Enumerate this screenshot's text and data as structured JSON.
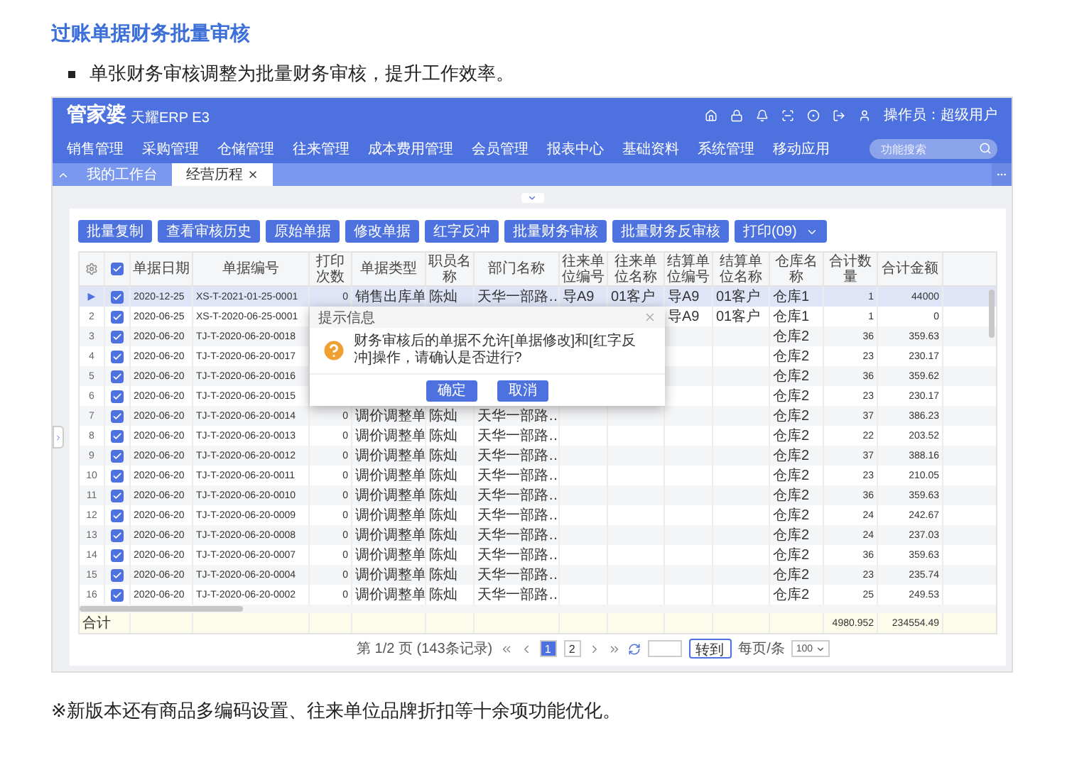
{
  "article": {
    "heading": "过账单据财务批量审核",
    "bullets": [
      "单张财务审核调整为批量财务审核，提升工作效率。"
    ],
    "note": "※新版本还有商品多编码设置、往来单位品牌折扣等十余项功能优化。"
  },
  "app": {
    "logo": "管家婆",
    "product": "天耀ERP E3",
    "operator": "操作员：超级用户",
    "search": {
      "placeholder": "功能搜索"
    },
    "nav": [
      "销售管理",
      "采购管理",
      "仓储管理",
      "往来管理",
      "成本费用管理",
      "会员管理",
      "报表中心",
      "基础资料",
      "系统管理",
      "移动应用"
    ],
    "tabs": [
      {
        "label": "我的工作台",
        "selected": false,
        "closable": false
      },
      {
        "label": "经营历程",
        "selected": true,
        "closable": true
      }
    ],
    "toolbar": [
      {
        "label": "批量复制",
        "caret": false
      },
      {
        "label": "查看审核历史",
        "caret": false
      },
      {
        "label": "原始单据",
        "caret": false
      },
      {
        "label": "修改单据",
        "caret": false
      },
      {
        "label": "红字反冲",
        "caret": false
      },
      {
        "label": "批量财务审核",
        "caret": false
      },
      {
        "label": "批量财务反审核",
        "caret": false
      },
      {
        "label": "打印(09)",
        "caret": true
      }
    ],
    "table": {
      "header_checked": true,
      "columns": [
        "单据日期",
        "单据编号",
        "打印次数",
        "单据类型",
        "职员名称",
        "部门名称",
        "往来单位编号",
        "往来单位名称",
        "结算单位编号",
        "结算单位名称",
        "仓库名称",
        "合计数量",
        "合计金额"
      ],
      "rows": [
        {
          "index": "▶",
          "selected": true,
          "checked": true,
          "cells": [
            "2020-12-25",
            "XS-T-2021-01-25-0001",
            "0",
            "销售出库单",
            "陈灿",
            "天华一部路…",
            "导A9",
            "01客户",
            "导A9",
            "01客户",
            "仓库1",
            "1",
            "44000"
          ]
        },
        {
          "index": "2",
          "selected": false,
          "checked": true,
          "cells": [
            "2020-06-25",
            "XS-T-2020-06-25-0001",
            null,
            null,
            null,
            null,
            null,
            null,
            "导A9",
            "01客户",
            "仓库1",
            "1",
            "0"
          ]
        },
        {
          "index": "3",
          "selected": false,
          "checked": true,
          "cells": [
            "2020-06-20",
            "TJ-T-2020-06-20-0018",
            null,
            null,
            null,
            null,
            null,
            null,
            null,
            null,
            "仓库2",
            "36",
            "359.63"
          ]
        },
        {
          "index": "4",
          "selected": false,
          "checked": true,
          "cells": [
            "2020-06-20",
            "TJ-T-2020-06-20-0017",
            null,
            null,
            null,
            null,
            null,
            null,
            null,
            null,
            "仓库2",
            "23",
            "230.17"
          ]
        },
        {
          "index": "5",
          "selected": false,
          "checked": true,
          "cells": [
            "2020-06-20",
            "TJ-T-2020-06-20-0016",
            null,
            null,
            null,
            null,
            null,
            null,
            null,
            null,
            "仓库2",
            "36",
            "359.62"
          ]
        },
        {
          "index": "6",
          "selected": false,
          "checked": true,
          "cells": [
            "2020-06-20",
            "TJ-T-2020-06-20-0015",
            null,
            null,
            null,
            null,
            null,
            null,
            null,
            null,
            "仓库2",
            "23",
            "230.17"
          ]
        },
        {
          "index": "7",
          "selected": false,
          "checked": true,
          "cells": [
            "2020-06-20",
            "TJ-T-2020-06-20-0014",
            "0",
            "调价调整单",
            "陈灿",
            "天华一部路…",
            null,
            null,
            null,
            null,
            "仓库2",
            "37",
            "386.23"
          ]
        },
        {
          "index": "8",
          "selected": false,
          "checked": true,
          "cells": [
            "2020-06-20",
            "TJ-T-2020-06-20-0013",
            "0",
            "调价调整单",
            "陈灿",
            "天华一部路…",
            null,
            null,
            null,
            null,
            "仓库2",
            "22",
            "203.52"
          ]
        },
        {
          "index": "9",
          "selected": false,
          "checked": true,
          "cells": [
            "2020-06-20",
            "TJ-T-2020-06-20-0012",
            "0",
            "调价调整单",
            "陈灿",
            "天华一部路…",
            null,
            null,
            null,
            null,
            "仓库2",
            "37",
            "388.16"
          ]
        },
        {
          "index": "10",
          "selected": false,
          "checked": true,
          "cells": [
            "2020-06-20",
            "TJ-T-2020-06-20-0011",
            "0",
            "调价调整单",
            "陈灿",
            "天华一部路…",
            null,
            null,
            null,
            null,
            "仓库2",
            "23",
            "210.05"
          ]
        },
        {
          "index": "11",
          "selected": false,
          "checked": true,
          "cells": [
            "2020-06-20",
            "TJ-T-2020-06-20-0010",
            "0",
            "调价调整单",
            "陈灿",
            "天华一部路…",
            null,
            null,
            null,
            null,
            "仓库2",
            "36",
            "359.63"
          ]
        },
        {
          "index": "12",
          "selected": false,
          "checked": true,
          "cells": [
            "2020-06-20",
            "TJ-T-2020-06-20-0009",
            "0",
            "调价调整单",
            "陈灿",
            "天华一部路…",
            null,
            null,
            null,
            null,
            "仓库2",
            "24",
            "242.67"
          ]
        },
        {
          "index": "13",
          "selected": false,
          "checked": true,
          "cells": [
            "2020-06-20",
            "TJ-T-2020-06-20-0008",
            "0",
            "调价调整单",
            "陈灿",
            "天华一部路…",
            null,
            null,
            null,
            null,
            "仓库2",
            "24",
            "237.03"
          ]
        },
        {
          "index": "14",
          "selected": false,
          "checked": true,
          "cells": [
            "2020-06-20",
            "TJ-T-2020-06-20-0007",
            "0",
            "调价调整单",
            "陈灿",
            "天华一部路…",
            null,
            null,
            null,
            null,
            "仓库2",
            "36",
            "359.63"
          ]
        },
        {
          "index": "15",
          "selected": false,
          "checked": true,
          "cells": [
            "2020-06-20",
            "TJ-T-2020-06-20-0004",
            "0",
            "调价调整单",
            "陈灿",
            "天华一部路…",
            null,
            null,
            null,
            null,
            "仓库2",
            "23",
            "235.74"
          ]
        },
        {
          "index": "16",
          "selected": false,
          "checked": true,
          "cells": [
            "2020-06-20",
            "TJ-T-2020-06-20-0002",
            "0",
            "调价调整单",
            "陈灿",
            "天华一部路…",
            null,
            null,
            null,
            null,
            "仓库2",
            "25",
            "249.53"
          ]
        }
      ],
      "total": {
        "label": "合计",
        "qty": "4980.952",
        "amount": "234554.49"
      }
    },
    "pager": {
      "info": "第 1/2 页 (143条记录)",
      "pages": [
        {
          "label": "1",
          "selected": true
        },
        {
          "label": "2",
          "selected": false
        }
      ],
      "goto": "转到",
      "per_page_label": "每页/条",
      "per_page": "100"
    },
    "dialog": {
      "title": "提示信息",
      "message": "财务审核后的单据不允许[单据修改]和[红字反冲]操作，请确认是否进行?",
      "buttons": [
        "确定",
        "取消"
      ]
    }
  }
}
